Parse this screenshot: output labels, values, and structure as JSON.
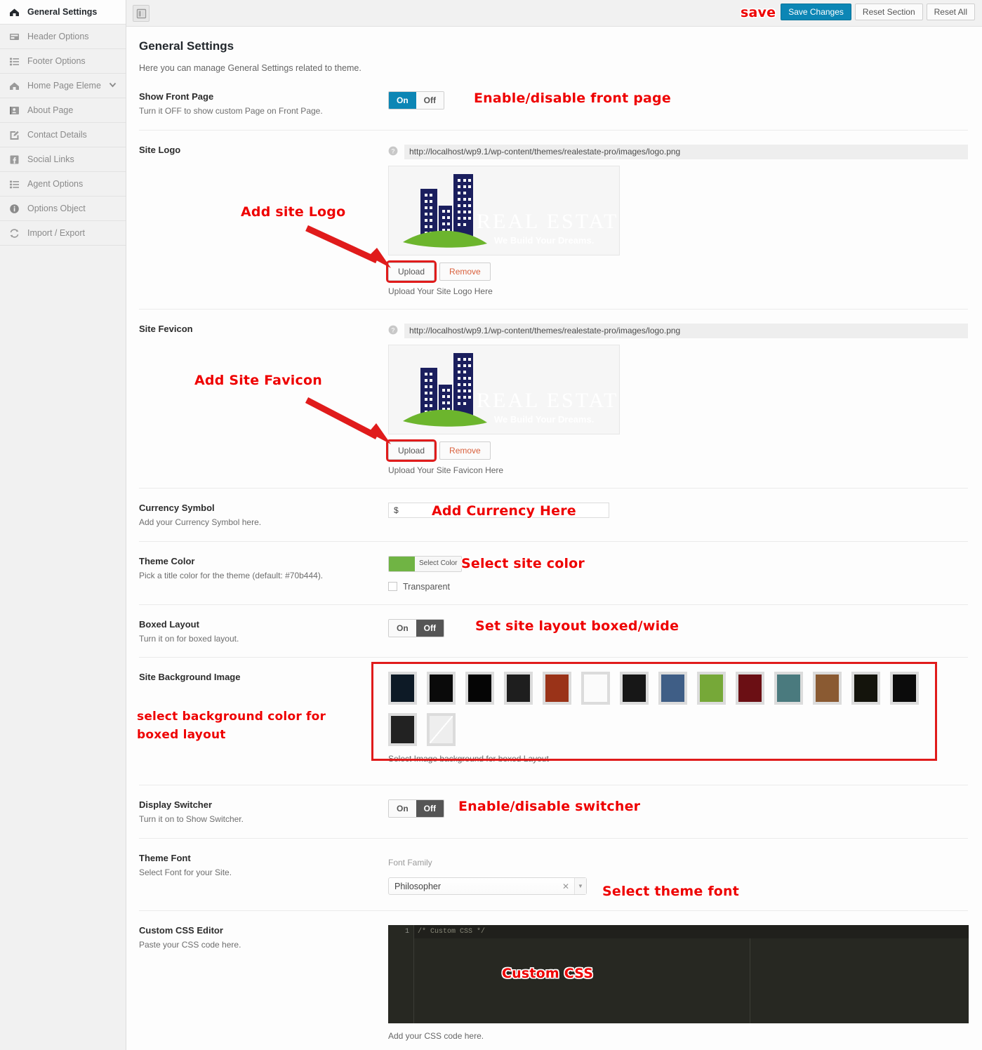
{
  "sidebar": {
    "items": [
      {
        "label": "General Settings",
        "icon": "home-icon",
        "active": true,
        "chevron": false
      },
      {
        "label": "Header Options",
        "icon": "header-icon",
        "active": false,
        "chevron": false
      },
      {
        "label": "Footer Options",
        "icon": "list-icon",
        "active": false,
        "chevron": false
      },
      {
        "label": "Home Page Element",
        "icon": "home-icon",
        "active": false,
        "chevron": true
      },
      {
        "label": "About Page",
        "icon": "contact-card-icon",
        "active": false,
        "chevron": false
      },
      {
        "label": "Contact Details",
        "icon": "edit-icon",
        "active": false,
        "chevron": false
      },
      {
        "label": "Social Links",
        "icon": "facebook-icon",
        "active": false,
        "chevron": false
      },
      {
        "label": "Agent Options",
        "icon": "list-icon",
        "active": false,
        "chevron": false
      },
      {
        "label": "Options Object",
        "icon": "info-icon",
        "active": false,
        "chevron": false
      },
      {
        "label": "Import / Export",
        "icon": "sync-icon",
        "active": false,
        "chevron": false
      }
    ]
  },
  "topbar": {
    "expand_icon": "panel-toggle-icon",
    "save_changes": "Save Changes",
    "reset_section": "Reset Section",
    "reset_all": "Reset All",
    "annotation_save": "save"
  },
  "page": {
    "title": "General Settings",
    "subtitle": "Here you can manage General Settings related to theme."
  },
  "fields": {
    "show_front_page": {
      "title": "Show Front Page",
      "desc": "Turn it OFF to show custom Page on Front Page.",
      "on": "On",
      "off": "Off",
      "state": "on",
      "annotation": "Enable/disable front page"
    },
    "site_logo": {
      "title": "Site Logo",
      "url": "http://localhost/wp9.1/wp-content/themes/realestate-pro/images/logo.png",
      "upload": "Upload",
      "remove": "Remove",
      "caption": "Upload Your Site Logo Here",
      "annotation": "Add site Logo",
      "logo_text_main": "REAL ESTATE",
      "logo_text_sub": "We Build Your Dreams."
    },
    "site_favicon": {
      "title": "Site Fevicon",
      "url": "http://localhost/wp9.1/wp-content/themes/realestate-pro/images/logo.png",
      "upload": "Upload",
      "remove": "Remove",
      "caption": "Upload Your Site Favicon Here",
      "annotation": "Add Site Favicon",
      "logo_text_main": "REAL ESTATE",
      "logo_text_sub": "We Build Your Dreams."
    },
    "currency_symbol": {
      "title": "Currency Symbol",
      "desc": "Add your Currency Symbol here.",
      "value": "$",
      "annotation": "Add Currency Here"
    },
    "theme_color": {
      "title": "Theme Color",
      "desc": "Pick a title color for the theme (default: #70b444).",
      "select_label": "Select Color",
      "color": "#70b444",
      "transparent_label": "Transparent",
      "transparent_checked": false,
      "annotation": "Select site color"
    },
    "boxed_layout": {
      "title": "Boxed Layout",
      "desc": "Turn it on for boxed layout.",
      "on": "On",
      "off": "Off",
      "state": "off",
      "annotation": "Set site layout boxed/wide"
    },
    "site_background_image": {
      "title": "Site Background Image",
      "caption": "Select Image background for boxed Layout",
      "annotation": "select background color for boxed layout",
      "swatches": [
        {
          "name": "blue-stripes",
          "color": "#0d1a26"
        },
        {
          "name": "black-noise",
          "color": "#0a0a0a"
        },
        {
          "name": "pure-black",
          "color": "#050505"
        },
        {
          "name": "dark-vertical",
          "color": "#1e1e1e"
        },
        {
          "name": "rust-red",
          "color": "#9a3318"
        },
        {
          "name": "white-paper",
          "color": "#fbfbfb"
        },
        {
          "name": "dark-smoke",
          "color": "#171717"
        },
        {
          "name": "blue-fabric",
          "color": "#3f5e86"
        },
        {
          "name": "green-solid",
          "color": "#76a838"
        },
        {
          "name": "dark-red-pattern",
          "color": "#6b0f14"
        },
        {
          "name": "teal-solid",
          "color": "#4a7a7e"
        },
        {
          "name": "brown-wood",
          "color": "#8a5a32"
        },
        {
          "name": "dark-olive",
          "color": "#14140c"
        },
        {
          "name": "black-dots",
          "color": "#0b0b0b"
        },
        {
          "name": "charcoal",
          "color": "#222222"
        },
        {
          "name": "none",
          "color": "#e8e8e8"
        }
      ]
    },
    "display_switcher": {
      "title": "Display Switcher",
      "desc": "Turn it on to Show Switcher.",
      "on": "On",
      "off": "Off",
      "state": "off",
      "annotation": "Enable/disable switcher"
    },
    "theme_font": {
      "title": "Theme Font",
      "desc": "Select Font for your Site.",
      "select_label": "Font Family",
      "value": "Philosopher",
      "annotation": "Select theme font"
    },
    "custom_css": {
      "title": "Custom CSS Editor",
      "desc": "Paste your CSS code here.",
      "line_number": "1",
      "code": "/* Custom CSS */",
      "caption": "Add your CSS code here.",
      "annotation": "Custom CSS"
    }
  },
  "colors": {
    "accent": "#0c86b5",
    "annotation_red": "#ee0000",
    "theme_green": "#70b444"
  }
}
